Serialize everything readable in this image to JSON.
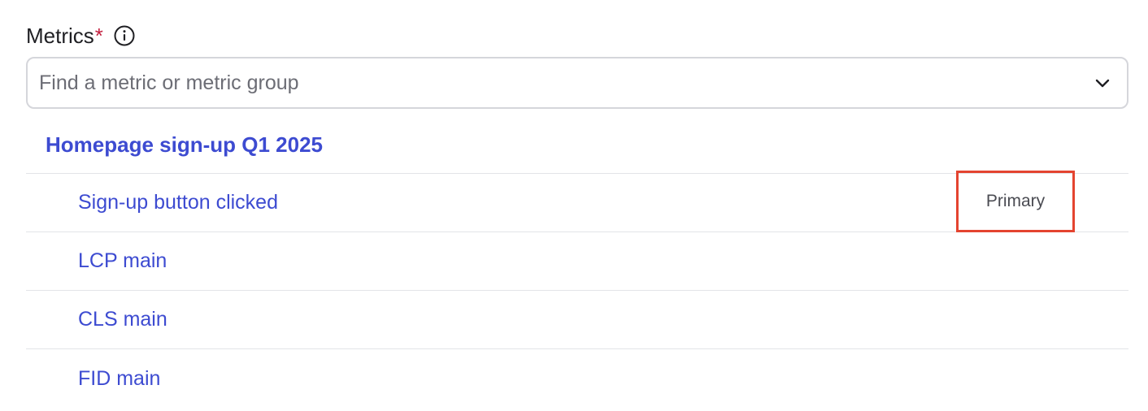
{
  "field": {
    "label": "Metrics",
    "required_marker": "*",
    "info_icon": "info-circle-icon"
  },
  "search": {
    "placeholder": "Find a metric or metric group",
    "value": "",
    "dropdown_icon": "chevron-down-icon"
  },
  "group": {
    "name": "Homepage sign-up Q1 2025",
    "color": "#3d4bd1"
  },
  "metrics": [
    {
      "name": "Sign-up button clicked",
      "badge": "Primary"
    },
    {
      "name": "LCP main",
      "badge": ""
    },
    {
      "name": "CLS main",
      "badge": ""
    },
    {
      "name": "FID main",
      "badge": ""
    }
  ],
  "colors": {
    "accent": "#3d4bd1",
    "required": "#c3203f",
    "highlight_border": "#e44430",
    "divider": "#e3e4e8"
  }
}
